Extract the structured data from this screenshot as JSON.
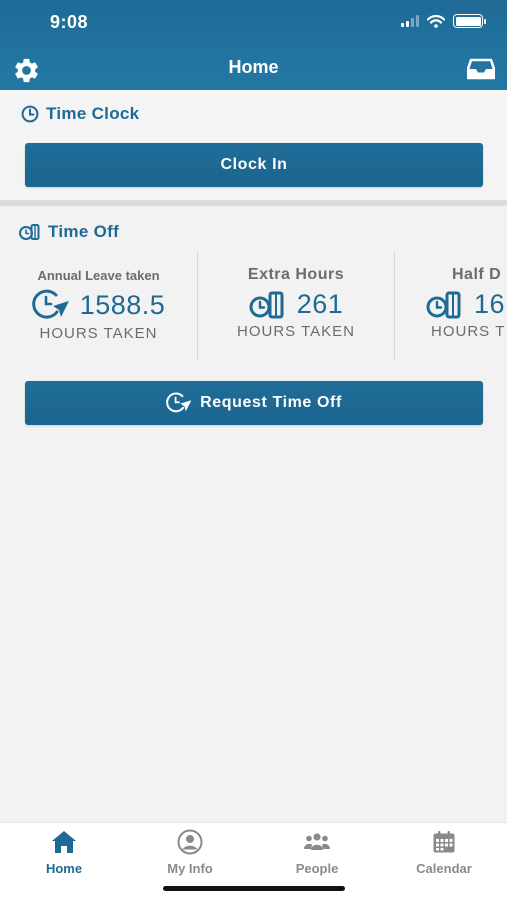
{
  "status_bar": {
    "time": "9:08"
  },
  "nav": {
    "title": "Home",
    "left_icon": "gear-icon",
    "right_icon": "inbox-icon"
  },
  "time_clock": {
    "heading": "Time Clock",
    "button_label": "Clock In"
  },
  "time_off": {
    "heading": "Time Off",
    "cards": [
      {
        "title": "Annual Leave taken",
        "value": "1588.5",
        "unit": "HOURS TAKEN",
        "icon": "clock-send-icon"
      },
      {
        "title": "Extra Hours",
        "value": "261",
        "unit": "HOURS TAKEN",
        "icon": "time-bank-icon"
      },
      {
        "title": "Half D",
        "value": "16",
        "unit": "HOURS T",
        "icon": "time-bank-icon"
      }
    ],
    "request_button_label": "Request Time Off"
  },
  "tabbar": {
    "items": [
      {
        "label": "Home",
        "icon": "home-icon",
        "active": true
      },
      {
        "label": "My Info",
        "icon": "person-circle-icon",
        "active": false
      },
      {
        "label": "People",
        "icon": "people-icon",
        "active": false
      },
      {
        "label": "Calendar",
        "icon": "calendar-icon",
        "active": false
      }
    ]
  },
  "colors": {
    "brand": "#1e6a95",
    "background": "#f2f2f2",
    "muted_text": "#6c6c6c"
  }
}
